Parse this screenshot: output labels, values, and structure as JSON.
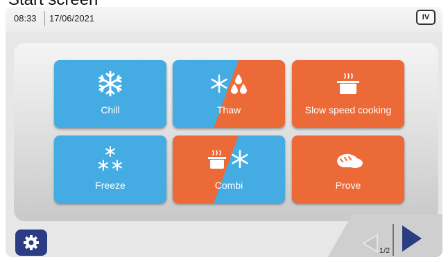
{
  "caption": "Start screen",
  "status": {
    "time": "08:33",
    "date": "17/06/2021",
    "level_badge": "IV"
  },
  "tiles": [
    {
      "label": "Chill",
      "icon": "snowflake-icon",
      "color": "#45ace3"
    },
    {
      "label": "Thaw",
      "icon": "snowflake-drops-icon",
      "colors": [
        "#45ace3",
        "#ec6a37"
      ]
    },
    {
      "label": "Slow speed cooking",
      "icon": "pot-icon",
      "color": "#ec6a37"
    },
    {
      "label": "Freeze",
      "icon": "triple-snowflake-icon",
      "color": "#45ace3"
    },
    {
      "label": "Combi",
      "icon": "pot-snowflake-icon",
      "colors": [
        "#ec6a37",
        "#45ace3"
      ]
    },
    {
      "label": "Prove",
      "icon": "bread-icon",
      "color": "#ec6a37"
    }
  ],
  "settings": {
    "icon": "gear-icon"
  },
  "pagination": {
    "page": "1/2",
    "prev_icon": "triangle-left-icon",
    "next_icon": "triangle-right-icon",
    "prev_color": "#c4c4c4",
    "next_color": "#2c3c83"
  }
}
